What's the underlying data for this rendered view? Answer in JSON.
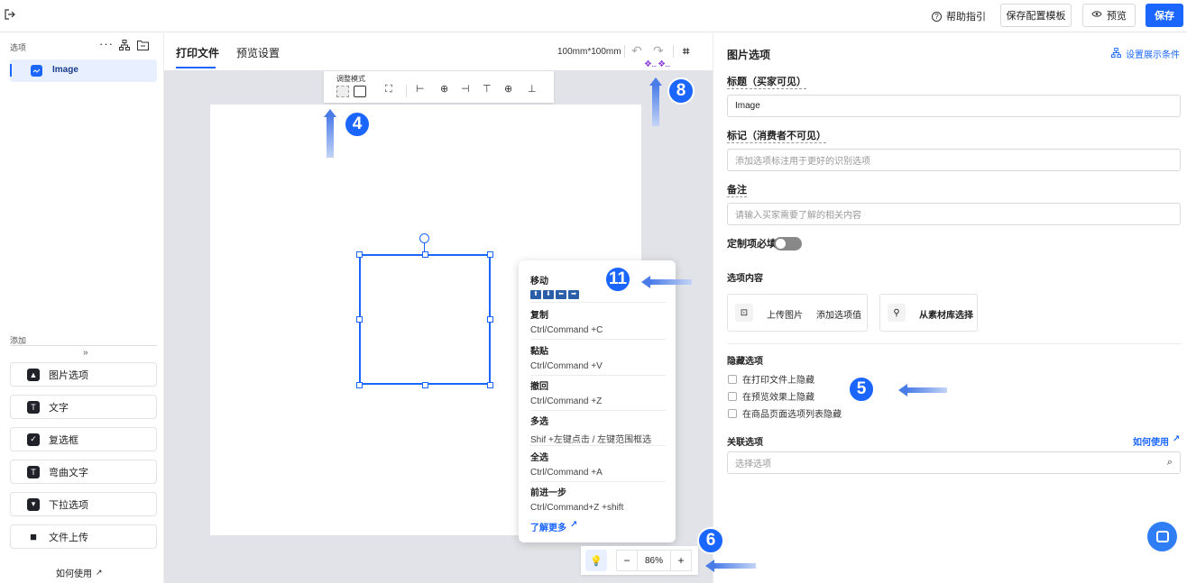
{
  "topbar": {
    "help": "帮助指引",
    "save_template": "保存配置模板",
    "preview": "预览",
    "save": "保存"
  },
  "left": {
    "options_title": "选项",
    "selected_item": "Image",
    "add_title": "添加",
    "add_items": [
      "图片选项",
      "文字",
      "复选框",
      "弯曲文字",
      "下拉选项",
      "文件上传"
    ],
    "how_to_use": "如何使用"
  },
  "tabs": {
    "print_file": "打印文件",
    "preview_settings": "预览设置",
    "size": "100mm*100mm"
  },
  "toolbar": {
    "adjust_mode": "调整模式"
  },
  "context_menu": {
    "items": [
      {
        "title": "移动",
        "shortcut": ""
      },
      {
        "title": "复制",
        "shortcut": "Ctrl/Command +C"
      },
      {
        "title": "黏贴",
        "shortcut": "Ctrl/Command +V"
      },
      {
        "title": "撤回",
        "shortcut": "Ctrl/Command +Z"
      },
      {
        "title": "多选",
        "shortcut": "Shif +左键点击 / 左键范围框选"
      },
      {
        "title": "全选",
        "shortcut": "Ctrl/Command +A"
      },
      {
        "title": "前进一步",
        "shortcut": "Ctrl/Command+Z +shift"
      }
    ],
    "learn_more": "了解更多"
  },
  "zoom": {
    "value": "86%",
    "minus": "−",
    "plus": "+"
  },
  "markers": [
    "4",
    "8",
    "11",
    "5",
    "6"
  ],
  "right": {
    "title": "图片选项",
    "display_condition": "设置展示条件",
    "title_label": "标题（买家可见）",
    "title_value": "Image",
    "mark_label": "标记（消费者不可见）",
    "mark_placeholder": "添加选项标注用于更好的识别选项",
    "note_label": "备注",
    "note_placeholder": "请输入买家需要了解的相关内容",
    "required_label": "定制项必填",
    "content_label": "选项内容",
    "upload_image": "上传图片",
    "add_value": "添加选项值",
    "from_library": "从素材库选择",
    "hide_label": "隐藏选项",
    "hide_options": [
      "在打印文件上隐藏",
      "在预览效果上隐藏",
      "在商品页面选项列表隐藏"
    ],
    "related_label": "关联选项",
    "how_to_use": "如何使用",
    "select_placeholder": "选择选项"
  },
  "colors": {
    "accent": "#1a66ff",
    "canvas_bg": "#e1e3e8"
  }
}
